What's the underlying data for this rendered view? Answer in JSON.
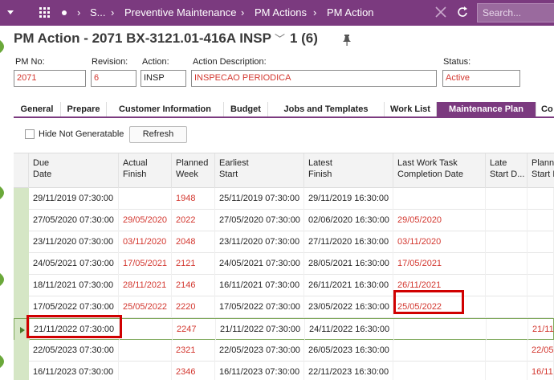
{
  "topbar": {
    "crumbs": [
      "S...",
      "Preventive Maintenance",
      "PM Actions",
      "PM Action"
    ],
    "search_placeholder": "Search...",
    "icons": [
      "menu-arrow-icon",
      "apps-grid-icon",
      "dot-icon",
      "close-icon",
      "refresh-icon"
    ]
  },
  "page": {
    "title": "PM Action - 2071 BX-3121.01-416A INSP",
    "count": "1 (6)"
  },
  "fields": {
    "pm_no": {
      "label": "PM No:",
      "value": "2071"
    },
    "revision": {
      "label": "Revision:",
      "value": "6"
    },
    "action": {
      "label": "Action:",
      "value": "INSP"
    },
    "action_description": {
      "label": "Action Description:",
      "value": "INSPECAO PERIODICA"
    },
    "status": {
      "label": "Status:",
      "value": "Active"
    }
  },
  "tabs": [
    "General",
    "Prepare",
    "Customer Information",
    "Budget",
    "Jobs and Templates",
    "Work List",
    "Maintenance Plan",
    "Co"
  ],
  "active_tab": "Maintenance Plan",
  "toolbar": {
    "hide_not_generatable": "Hide Not Generatable",
    "refresh": "Refresh"
  },
  "grid": {
    "columns": [
      {
        "l1": "Due",
        "l2": "Date"
      },
      {
        "l1": "Actual",
        "l2": "Finish"
      },
      {
        "l1": "Planned",
        "l2": "Week"
      },
      {
        "l1": "Earliest",
        "l2": "Start"
      },
      {
        "l1": "Latest",
        "l2": "Finish"
      },
      {
        "l1": "Last Work Task",
        "l2": "Completion Date"
      },
      {
        "l1": "Late",
        "l2": "Start D..."
      },
      {
        "l1": "Plann",
        "l2": "Start I"
      }
    ],
    "rows": [
      {
        "due": "29/11/2019 07:30:00",
        "actual": "",
        "week": "1948",
        "earliest": "25/11/2019 07:30:00",
        "latest": "29/11/2019 16:30:00",
        "last": "",
        "late": "",
        "planned_start": ""
      },
      {
        "due": "27/05/2020 07:30:00",
        "actual": "29/05/2020",
        "week": "2022",
        "earliest": "27/05/2020 07:30:00",
        "latest": "02/06/2020 16:30:00",
        "last": "29/05/2020",
        "late": "",
        "planned_start": ""
      },
      {
        "due": "23/11/2020 07:30:00",
        "actual": "03/11/2020",
        "week": "2048",
        "earliest": "23/11/2020 07:30:00",
        "latest": "27/11/2020 16:30:00",
        "last": "03/11/2020",
        "late": "",
        "planned_start": ""
      },
      {
        "due": "24/05/2021 07:30:00",
        "actual": "17/05/2021",
        "week": "2121",
        "earliest": "24/05/2021 07:30:00",
        "latest": "28/05/2021 16:30:00",
        "last": "17/05/2021",
        "late": "",
        "planned_start": ""
      },
      {
        "due": "18/11/2021 07:30:00",
        "actual": "28/11/2021",
        "week": "2146",
        "earliest": "16/11/2021 07:30:00",
        "latest": "26/11/2021 16:30:00",
        "last": "26/11/2021",
        "late": "",
        "planned_start": ""
      },
      {
        "due": "17/05/2022 07:30:00",
        "actual": "25/05/2022",
        "week": "2220",
        "earliest": "17/05/2022 07:30:00",
        "latest": "23/05/2022 16:30:00",
        "last": "25/05/2022",
        "late": "",
        "planned_start": ""
      },
      {
        "due": "21/11/2022 07:30:00",
        "actual": "",
        "week": "2247",
        "earliest": "21/11/2022 07:30:00",
        "latest": "24/11/2022 16:30:00",
        "last": "",
        "late": "",
        "planned_start": "21/11/"
      },
      {
        "due": "22/05/2023 07:30:00",
        "actual": "",
        "week": "2321",
        "earliest": "22/05/2023 07:30:00",
        "latest": "26/05/2023 16:30:00",
        "last": "",
        "late": "",
        "planned_start": "22/05/"
      },
      {
        "due": "16/11/2023 07:30:00",
        "actual": "",
        "week": "2346",
        "earliest": "16/11/2023 07:30:00",
        "latest": "22/11/2023 16:30:00",
        "last": "",
        "late": "",
        "planned_start": "16/11/"
      }
    ]
  },
  "colors": {
    "brand": "#7b3a7f",
    "red_value": "#d3372f",
    "highlight": "#d00000",
    "selected_marker": "#d5e6c5"
  }
}
